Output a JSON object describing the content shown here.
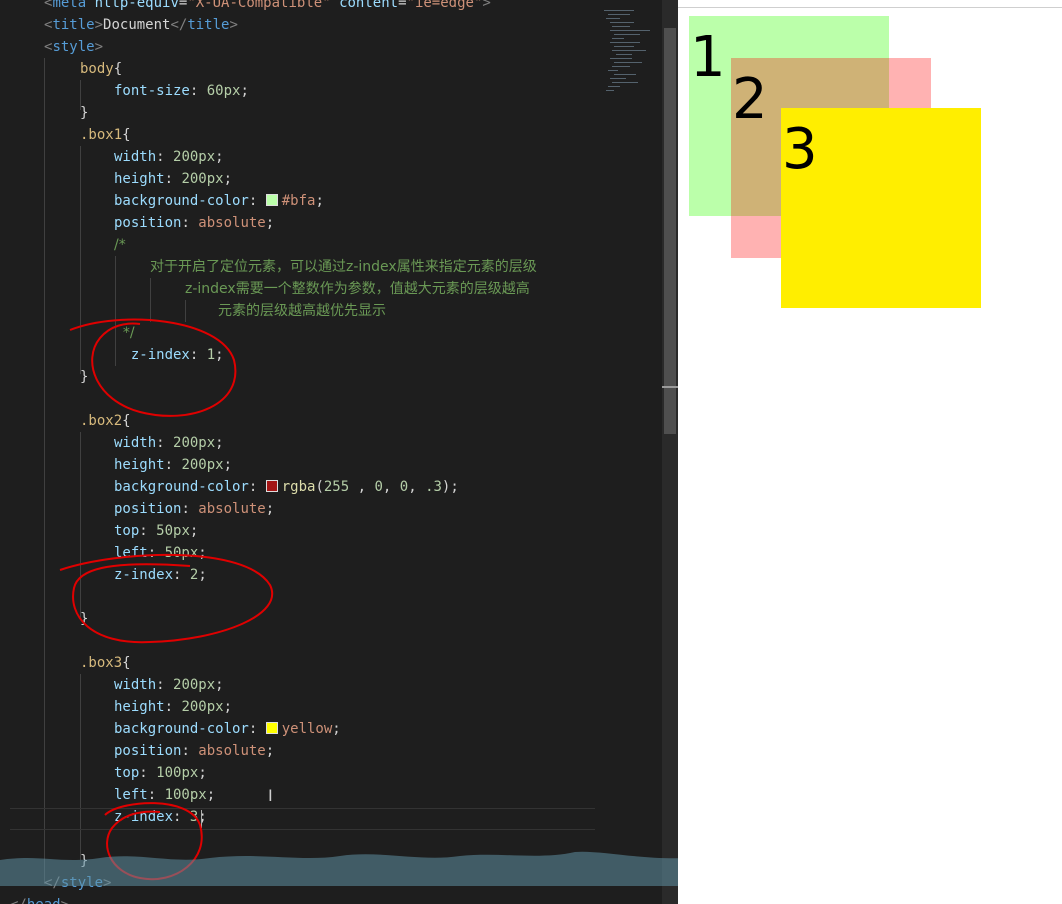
{
  "editor": {
    "lines": [
      {
        "indent": 1,
        "parts": [
          [
            "t-punct",
            "<"
          ],
          [
            "t-tag",
            "meta "
          ],
          [
            "t-attr",
            "http-equiv"
          ],
          [
            "t-text",
            "="
          ],
          [
            "t-str",
            "\"X-UA-Compatible\""
          ],
          [
            "t-text",
            " "
          ],
          [
            "t-attr",
            "content"
          ],
          [
            "t-text",
            "="
          ],
          [
            "t-str",
            "\"ie=edge\""
          ],
          [
            "t-punct",
            ">"
          ]
        ]
      },
      {
        "indent": 1,
        "parts": [
          [
            "t-punct",
            "<"
          ],
          [
            "t-tag",
            "title"
          ],
          [
            "t-punct",
            ">"
          ],
          [
            "t-text",
            "Document"
          ],
          [
            "t-punct",
            "</"
          ],
          [
            "t-tag",
            "title"
          ],
          [
            "t-punct",
            ">"
          ]
        ]
      },
      {
        "indent": 1,
        "parts": [
          [
            "t-punct",
            "<"
          ],
          [
            "t-tag",
            "style"
          ],
          [
            "t-punct",
            ">"
          ]
        ]
      },
      {
        "indent": 2,
        "parts": [
          [
            "t-sel",
            "body"
          ],
          [
            "t-text",
            "{"
          ]
        ]
      },
      {
        "indent": 3,
        "parts": [
          [
            "t-prop",
            "font-size"
          ],
          [
            "t-text",
            ": "
          ],
          [
            "t-num",
            "60px"
          ],
          [
            "t-text",
            ";"
          ]
        ]
      },
      {
        "indent": 2,
        "parts": [
          [
            "t-text",
            "}"
          ]
        ]
      },
      {
        "indent": 2,
        "parts": [
          [
            "t-sel",
            ".box1"
          ],
          [
            "t-text",
            "{"
          ]
        ]
      },
      {
        "indent": 3,
        "parts": [
          [
            "t-prop",
            "width"
          ],
          [
            "t-text",
            ": "
          ],
          [
            "t-num",
            "200px"
          ],
          [
            "t-text",
            ";"
          ]
        ]
      },
      {
        "indent": 3,
        "parts": [
          [
            "t-prop",
            "height"
          ],
          [
            "t-text",
            ": "
          ],
          [
            "t-num",
            "200px"
          ],
          [
            "t-text",
            ";"
          ]
        ]
      },
      {
        "indent": 3,
        "parts": [
          [
            "t-prop",
            "background-color"
          ],
          [
            "t-text",
            ": "
          ],
          [
            "swatch",
            "#bbffaa"
          ],
          [
            "t-kw",
            "#bfa"
          ],
          [
            "t-text",
            ";"
          ]
        ]
      },
      {
        "indent": 3,
        "parts": [
          [
            "t-prop",
            "position"
          ],
          [
            "t-text",
            ": "
          ],
          [
            "t-kw",
            "absolute"
          ],
          [
            "t-text",
            ";"
          ]
        ]
      },
      {
        "indent": 3,
        "parts": [
          [
            "t-comment",
            "/*"
          ]
        ]
      },
      {
        "indent": 4,
        "parts": [
          [
            "t-comment",
            "对于开启了定位元素，可以通过z-index属性来指定元素的层级"
          ]
        ]
      },
      {
        "indent": 5,
        "parts": [
          [
            "t-comment",
            "z-index需要一个整数作为参数，值越大元素的层级越高"
          ]
        ]
      },
      {
        "indent": 6,
        "parts": [
          [
            "t-comment",
            "元素的层级越高越优先显示"
          ]
        ]
      },
      {
        "indent": 3,
        "parts": [
          [
            "t-comment",
            "  */"
          ]
        ]
      },
      {
        "indent": 3,
        "parts": [
          [
            "t-prop",
            "  z-index"
          ],
          [
            "t-text",
            ": "
          ],
          [
            "t-num",
            "1"
          ],
          [
            "t-text",
            ";"
          ]
        ]
      },
      {
        "indent": 2,
        "parts": [
          [
            "t-text",
            "}"
          ]
        ]
      },
      {
        "indent": 0,
        "parts": []
      },
      {
        "indent": 2,
        "parts": [
          [
            "t-sel",
            ".box2"
          ],
          [
            "t-text",
            "{"
          ]
        ]
      },
      {
        "indent": 3,
        "parts": [
          [
            "t-prop",
            "width"
          ],
          [
            "t-text",
            ": "
          ],
          [
            "t-num",
            "200px"
          ],
          [
            "t-text",
            ";"
          ]
        ]
      },
      {
        "indent": 3,
        "parts": [
          [
            "t-prop",
            "height"
          ],
          [
            "t-text",
            ": "
          ],
          [
            "t-num",
            "200px"
          ],
          [
            "t-text",
            ";"
          ]
        ]
      },
      {
        "indent": 3,
        "parts": [
          [
            "t-prop",
            "background-color"
          ],
          [
            "t-text",
            ": "
          ],
          [
            "swatch",
            "#a31515"
          ],
          [
            "t-fn",
            "rgba"
          ],
          [
            "t-text",
            "("
          ],
          [
            "t-num",
            "255"
          ],
          [
            "t-text",
            " , "
          ],
          [
            "t-num",
            "0"
          ],
          [
            "t-text",
            ", "
          ],
          [
            "t-num",
            "0"
          ],
          [
            "t-text",
            ", "
          ],
          [
            "t-num",
            ".3"
          ],
          [
            "t-text",
            ");"
          ]
        ]
      },
      {
        "indent": 3,
        "parts": [
          [
            "t-prop",
            "position"
          ],
          [
            "t-text",
            ": "
          ],
          [
            "t-kw",
            "absolute"
          ],
          [
            "t-text",
            ";"
          ]
        ]
      },
      {
        "indent": 3,
        "parts": [
          [
            "t-prop",
            "top"
          ],
          [
            "t-text",
            ": "
          ],
          [
            "t-num",
            "50px"
          ],
          [
            "t-text",
            ";"
          ]
        ]
      },
      {
        "indent": 3,
        "parts": [
          [
            "t-prop",
            "left"
          ],
          [
            "t-text",
            ": "
          ],
          [
            "t-num",
            "50px"
          ],
          [
            "t-text",
            ";"
          ]
        ]
      },
      {
        "indent": 3,
        "parts": [
          [
            "t-prop",
            "z-index"
          ],
          [
            "t-text",
            ": "
          ],
          [
            "t-num",
            "2"
          ],
          [
            "t-text",
            ";"
          ]
        ]
      },
      {
        "indent": 0,
        "parts": []
      },
      {
        "indent": 2,
        "parts": [
          [
            "t-text",
            "}"
          ]
        ]
      },
      {
        "indent": 0,
        "parts": []
      },
      {
        "indent": 2,
        "parts": [
          [
            "t-sel",
            ".box3"
          ],
          [
            "t-text",
            "{"
          ]
        ]
      },
      {
        "indent": 3,
        "parts": [
          [
            "t-prop",
            "width"
          ],
          [
            "t-text",
            ": "
          ],
          [
            "t-num",
            "200px"
          ],
          [
            "t-text",
            ";"
          ]
        ]
      },
      {
        "indent": 3,
        "parts": [
          [
            "t-prop",
            "height"
          ],
          [
            "t-text",
            ": "
          ],
          [
            "t-num",
            "200px"
          ],
          [
            "t-text",
            ";"
          ]
        ]
      },
      {
        "indent": 3,
        "parts": [
          [
            "t-prop",
            "background-color"
          ],
          [
            "t-text",
            ": "
          ],
          [
            "swatch",
            "#ffff00"
          ],
          [
            "t-kw",
            "yellow"
          ],
          [
            "t-text",
            ";"
          ]
        ]
      },
      {
        "indent": 3,
        "parts": [
          [
            "t-prop",
            "position"
          ],
          [
            "t-text",
            ": "
          ],
          [
            "t-kw",
            "absolute"
          ],
          [
            "t-text",
            ";"
          ]
        ]
      },
      {
        "indent": 3,
        "parts": [
          [
            "t-prop",
            "top"
          ],
          [
            "t-text",
            ": "
          ],
          [
            "t-num",
            "100px"
          ],
          [
            "t-text",
            ";"
          ]
        ]
      },
      {
        "indent": 3,
        "parts": [
          [
            "t-prop",
            "left"
          ],
          [
            "t-text",
            ": "
          ],
          [
            "t-num",
            "100px"
          ],
          [
            "t-text",
            ";"
          ]
        ]
      },
      {
        "indent": 3,
        "parts": [
          [
            "t-prop",
            "z-index"
          ],
          [
            "t-text",
            ": "
          ],
          [
            "t-num",
            "3"
          ],
          [
            "t-text",
            ";"
          ]
        ]
      },
      {
        "indent": 0,
        "parts": []
      },
      {
        "indent": 2,
        "parts": [
          [
            "t-text",
            "}"
          ]
        ]
      },
      {
        "indent": 1,
        "parts": [
          [
            "t-punct",
            "</"
          ],
          [
            "t-tag",
            "style"
          ],
          [
            "t-punct",
            ">"
          ]
        ]
      },
      {
        "indent": 0,
        "parts": [
          [
            "t-punct",
            "</"
          ],
          [
            "t-tag",
            "head"
          ],
          [
            "t-punct",
            ">"
          ]
        ]
      }
    ]
  },
  "preview": {
    "boxes": [
      {
        "label": "1",
        "color": "#bbffaa",
        "opacity": 1
      },
      {
        "label": "2",
        "color": "#ff0000",
        "opacity": 0.3
      },
      {
        "label": "3",
        "color": "#ffee00",
        "opacity": 1
      }
    ]
  },
  "colors": {
    "editor_bg": "#1e1e1e",
    "annotation_red": "#e00000"
  }
}
